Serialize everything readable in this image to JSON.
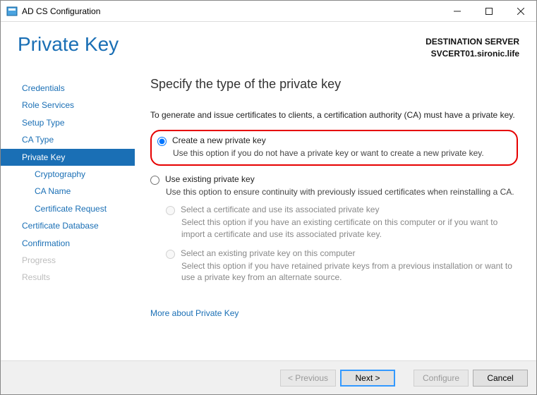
{
  "window": {
    "title": "AD CS Configuration"
  },
  "header": {
    "page_title": "Private Key",
    "dest_label": "DESTINATION SERVER",
    "dest_server": "SVCERT01.sironic.life"
  },
  "sidebar": {
    "items": [
      {
        "label": "Credentials",
        "state": "normal"
      },
      {
        "label": "Role Services",
        "state": "normal"
      },
      {
        "label": "Setup Type",
        "state": "normal"
      },
      {
        "label": "CA Type",
        "state": "normal"
      },
      {
        "label": "Private Key",
        "state": "selected"
      },
      {
        "label": "Cryptography",
        "state": "normal",
        "sub": true
      },
      {
        "label": "CA Name",
        "state": "normal",
        "sub": true
      },
      {
        "label": "Certificate Request",
        "state": "normal",
        "sub": true
      },
      {
        "label": "Certificate Database",
        "state": "normal"
      },
      {
        "label": "Confirmation",
        "state": "normal"
      },
      {
        "label": "Progress",
        "state": "disabled"
      },
      {
        "label": "Results",
        "state": "disabled"
      }
    ]
  },
  "content": {
    "heading": "Specify the type of the private key",
    "lead": "To generate and issue certificates to clients, a certification authority (CA) must have a private key.",
    "opt1_label": "Create a new private key",
    "opt1_desc": "Use this option if you do not have a private key or want to create a new private key.",
    "opt2_label": "Use existing private key",
    "opt2_desc": "Use this option to ensure continuity with previously issued certificates when reinstalling a CA.",
    "sub1_label": "Select a certificate and use its associated private key",
    "sub1_desc": "Select this option if you have an existing certificate on this computer or if you want to import a certificate and use its associated private key.",
    "sub2_label": "Select an existing private key on this computer",
    "sub2_desc": "Select this option if you have retained private keys from a previous installation or want to use a private key from an alternate source.",
    "more_link": "More about Private Key"
  },
  "footer": {
    "previous": "< Previous",
    "next": "Next >",
    "configure": "Configure",
    "cancel": "Cancel"
  }
}
